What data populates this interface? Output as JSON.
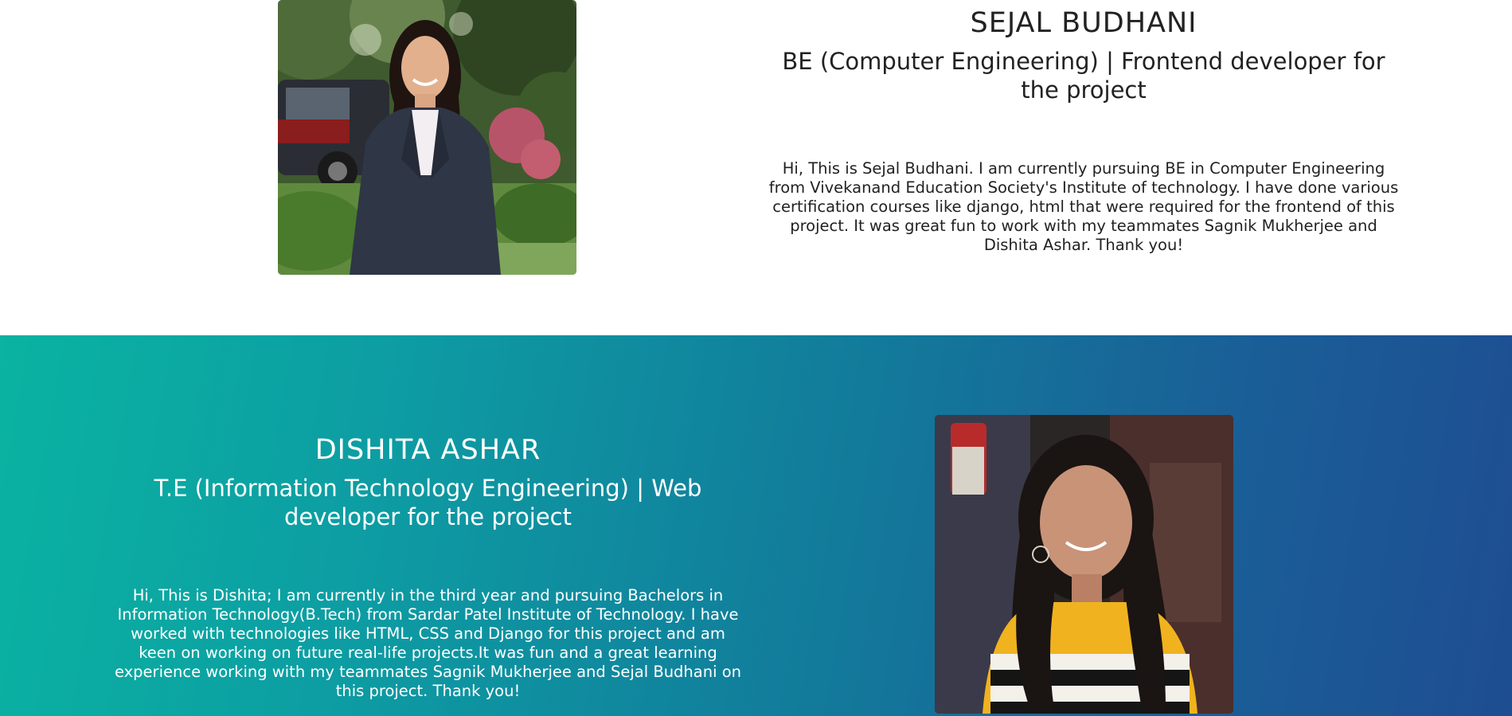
{
  "members": {
    "sejal": {
      "name": "SEJAL BUDHANI",
      "role": "BE (Computer Engineering) | Frontend developer for the project",
      "bio": "Hi, This is Sejal Budhani. I am currently pursuing BE in Computer Engineering from Vivekanand Education Society's Institute of technology. I have done various certification courses like django, html that were required for the frontend of this project. It was great fun to work with my teammates Sagnik Mukherjee and Dishita Ashar. Thank you!"
    },
    "dishita": {
      "name": "DISHITA ASHAR",
      "role": "T.E (Information Technology Engineering) | Web developer for the project",
      "bio": "Hi, This is Dishita; I am currently in the third year and pursuing Bachelors in Information Technology(B.Tech) from Sardar Patel Institute of Technology. I have worked with technologies like HTML, CSS and Django for this project and am keen on working on future real-life projects.It was fun and a great learning experience working with my teammates Sagnik Mukherjee and Sejal Budhani on this project. Thank you!"
    }
  },
  "colors": {
    "gradient_start": "#0ab3a2",
    "gradient_end": "#1e4d92",
    "text_dark": "#222222",
    "text_light": "#ffffff"
  }
}
